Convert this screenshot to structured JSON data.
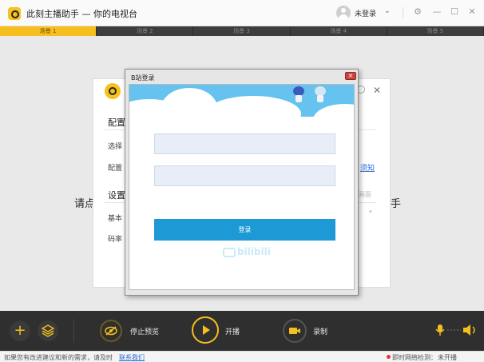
{
  "app": {
    "title": "此刻主播助手 — 你的电视台",
    "login_status": "未登录",
    "caret": "⌄"
  },
  "window_controls": {
    "settings_glyph": "⚙",
    "minimize_glyph": "—",
    "maximize_glyph": "☐",
    "close_glyph": "✕"
  },
  "scenes": [
    {
      "label": "场景 1",
      "active": true
    },
    {
      "label": "场景 2",
      "active": false
    },
    {
      "label": "场景 3",
      "active": false
    },
    {
      "label": "场景 4",
      "active": false
    },
    {
      "label": "场景 5",
      "active": false
    }
  ],
  "background": {
    "prompt_left": "请点",
    "prompt_right": "手",
    "section1_heading": "配置",
    "label_select": "选择",
    "label_config": "配置",
    "section2_heading": "设置",
    "label_basic": "基本",
    "label_bitrate": "码率",
    "link_fragment": "须知",
    "dim_fragment": "画面",
    "arrow": "▾",
    "close_glyph": "✕"
  },
  "login_dialog": {
    "title": "B站登录",
    "close_glyph": "×",
    "username_value": "",
    "password_value": "",
    "login_button": "登录",
    "watermark": "bilibili"
  },
  "toolbar": {
    "add_glyph": "+",
    "stop_preview_label": "停止预览",
    "start_stream_label": "开播",
    "record_label": "录制"
  },
  "status_bar": {
    "feedback_text": "如果您有改进建议和新的需求，请及时",
    "feedback_link": "联系我们",
    "network_label": "即时网络检测：",
    "network_value": "未开播"
  },
  "colors": {
    "accent": "#f6bf1f",
    "login_button": "#1d9ad6",
    "toolbar": "#2f2f2f",
    "link": "#2a6fd6",
    "alert_dot": "#ee3333"
  }
}
